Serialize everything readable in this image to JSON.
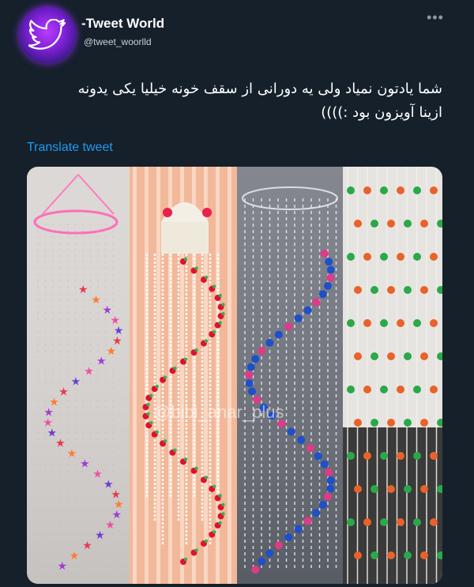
{
  "tweet": {
    "display_name": "-Tweet World",
    "handle": "@tweet_woorlld",
    "more_icon": "more-icon",
    "text_line1": "شما یادتون نمیاد ولی یه دورانی از سقف خونه خیلیا یکی یدونه",
    "text_line2": "ازینا آویزون بود :))))",
    "translate_label": "Translate tweet"
  },
  "media": {
    "watermark": "@bibi_anar_plus",
    "panels": [
      "pink-hanging-mobile",
      "white-red-bead-chandelier",
      "blue-pink-bead-spiral",
      "green-orange-bead-mobile"
    ]
  },
  "colors": {
    "background": "#15202b",
    "link": "#1d9bf0",
    "text": "#ffffff",
    "secondary": "#8b98a5"
  }
}
